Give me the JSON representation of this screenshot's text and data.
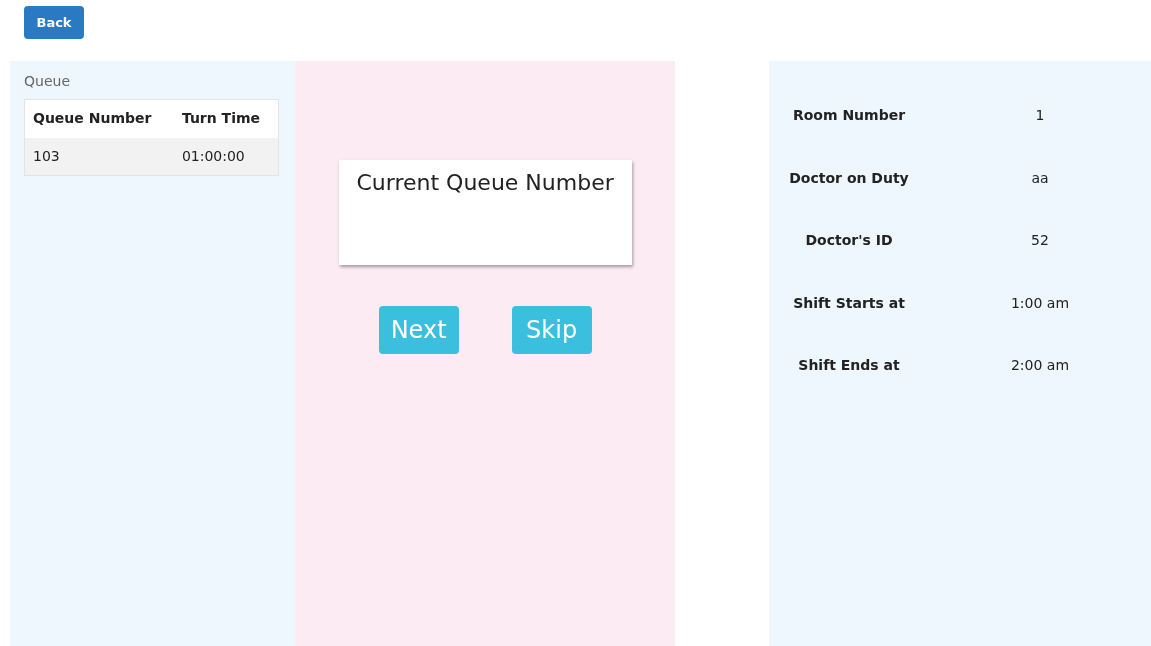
{
  "back_button": "Back",
  "queue": {
    "title": "Queue",
    "columns": [
      "Queue Number",
      "Turn Time"
    ],
    "rows": [
      [
        "103",
        "01:00:00"
      ]
    ]
  },
  "current": {
    "title": "Current Queue Number"
  },
  "actions": [
    "Next",
    "Skip"
  ],
  "details": [
    {
      "label": "Room Number",
      "value": "1"
    },
    {
      "label": "Doctor on Duty",
      "value": "aa"
    },
    {
      "label": "Doctor's ID",
      "value": "52"
    },
    {
      "label": "Shift Starts at",
      "value": "1:00 am"
    },
    {
      "label": "Shift Ends at",
      "value": "2:00 am"
    }
  ]
}
